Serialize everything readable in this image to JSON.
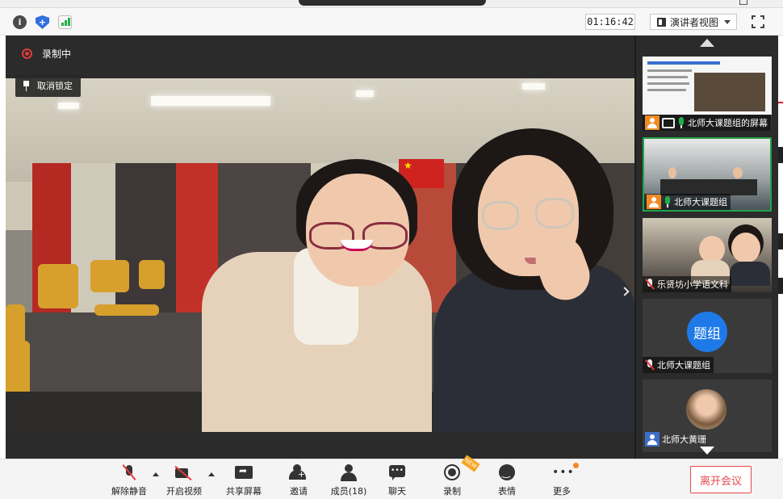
{
  "topbar": {
    "timer": "01:16:42",
    "view_mode_label": "演讲者视图"
  },
  "main": {
    "recording_label": "录制中",
    "unpin_label": "取消锁定"
  },
  "participants": [
    {
      "label": "北师大课题组的屏幕",
      "mic": "on",
      "active": false,
      "type": "screen"
    },
    {
      "label": "北师大课题组",
      "mic": "on",
      "active": true,
      "type": "room"
    },
    {
      "label": "乐贤坊小学语文科",
      "mic": "off",
      "active": false,
      "type": "room2"
    },
    {
      "label": "北师大课题组",
      "mic": "off",
      "active": false,
      "type": "avatar",
      "avatar_text": "题组"
    },
    {
      "label": "北师大黄珊",
      "mic": "",
      "active": false,
      "type": "photo"
    }
  ],
  "toolbar": {
    "unmute_label": "解除静音",
    "start_video_label": "开启视频",
    "share_screen_label": "共享屏幕",
    "invite_label": "邀请",
    "members_label": "成员(18)",
    "chat_label": "聊天",
    "record_label": "录制",
    "reactions_label": "表情",
    "more_label": "更多",
    "leave_label": "离开会议",
    "record_badge": "NEW"
  },
  "colors": {
    "leave_red": "#e5484d",
    "active_green": "#23a34a",
    "record_red": "#e23b3b",
    "avatar_blue": "#1f7ae9"
  }
}
